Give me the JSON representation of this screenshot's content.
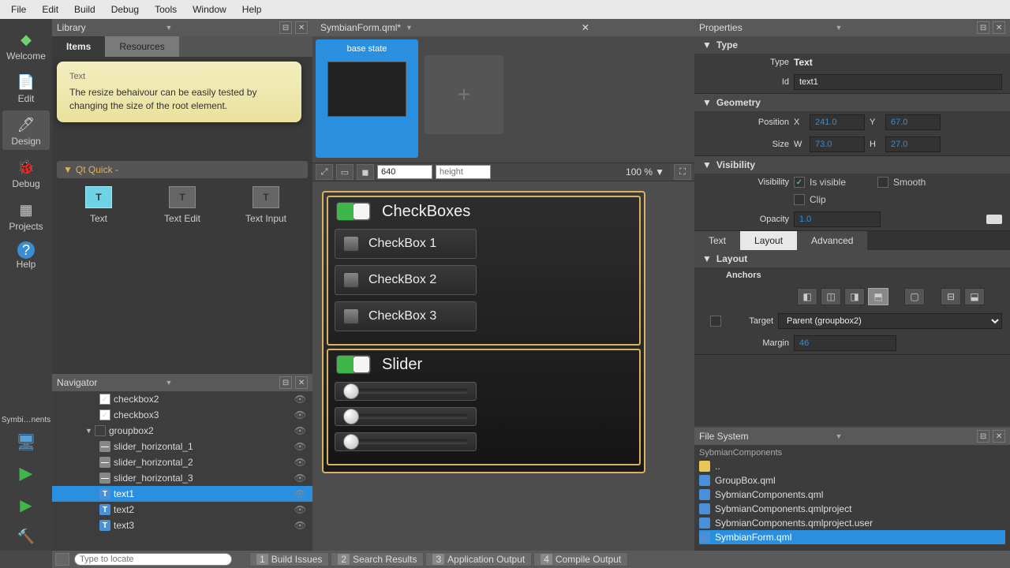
{
  "menu": [
    "File",
    "Edit",
    "Build",
    "Debug",
    "Tools",
    "Window",
    "Help"
  ],
  "sidebar": {
    "modes": [
      {
        "label": "Welcome",
        "icon": "◆"
      },
      {
        "label": "Edit",
        "icon": "✎"
      },
      {
        "label": "Design",
        "icon": "✐",
        "selected": true
      },
      {
        "label": "Debug",
        "icon": "🐞"
      },
      {
        "label": "Projects",
        "icon": "▦"
      },
      {
        "label": "Help",
        "icon": "?"
      }
    ],
    "target_label": "Symbi…nents"
  },
  "library": {
    "header": "Library",
    "tabs": [
      "Items",
      "Resources"
    ],
    "tooltip_title": "Text",
    "tooltip_body": "The resize behaivour can be easily tested by changing the size of the root element.",
    "section": "Qt Quick -",
    "items": [
      {
        "label": "Text",
        "selected": true
      },
      {
        "label": "Text Edit"
      },
      {
        "label": "Text Input"
      }
    ]
  },
  "navigator": {
    "header": "Navigator",
    "rows": [
      {
        "indent": 2,
        "check": true,
        "label": "checkbox2"
      },
      {
        "indent": 2,
        "check": true,
        "label": "checkbox3"
      },
      {
        "indent": 1,
        "arrow": true,
        "empty": true,
        "label": "groupbox2"
      },
      {
        "indent": 2,
        "slider": true,
        "label": "slider_horizontal_1"
      },
      {
        "indent": 2,
        "slider": true,
        "label": "slider_horizontal_2"
      },
      {
        "indent": 2,
        "slider": true,
        "label": "slider_horizontal_3"
      },
      {
        "indent": 2,
        "text": true,
        "label": "text1",
        "selected": true
      },
      {
        "indent": 2,
        "text": true,
        "label": "text2"
      },
      {
        "indent": 2,
        "text": true,
        "label": "text3"
      }
    ]
  },
  "editor": {
    "filename": "SymbianForm.qml*",
    "base_state": "base state",
    "width_input": "640",
    "height_placeholder": "height",
    "zoom": "100 %",
    "groupbox1": {
      "title": "CheckBoxes",
      "items": [
        "CheckBox 1",
        "CheckBox 2",
        "CheckBox 3"
      ]
    },
    "groupbox2": {
      "title": "Slider",
      "count": 3
    }
  },
  "properties": {
    "header": "Properties",
    "type_label": "Type",
    "type_value": "Text",
    "id_label": "Id",
    "id_value": "text1",
    "geometry": "Geometry",
    "position_label": "Position",
    "x_label": "X",
    "x_value": "241.0",
    "y_label": "Y",
    "y_value": "67.0",
    "size_label": "Size",
    "w_label": "W",
    "w_value": "73.0",
    "h_label": "H",
    "h_value": "27.0",
    "visibility": "Visibility",
    "vis_label": "Visibility",
    "is_visible": "Is visible",
    "smooth": "Smooth",
    "clip": "Clip",
    "opacity_label": "Opacity",
    "opacity_value": "1.0",
    "tabs": [
      "Text",
      "Layout",
      "Advanced"
    ],
    "layout": "Layout",
    "anchors": "Anchors",
    "target_label": "Target",
    "target_value": "Parent (groupbox2)",
    "margin_label": "Margin",
    "margin_value": "46"
  },
  "filesys": {
    "header": "File System",
    "root": "SybmianComponents",
    "items": [
      {
        "label": "..",
        "folder": true
      },
      {
        "label": "GroupBox.qml"
      },
      {
        "label": "SybmianComponents.qml"
      },
      {
        "label": "SybmianComponents.qmlproject"
      },
      {
        "label": "SybmianComponents.qmlproject.user"
      },
      {
        "label": "SymbianForm.qml",
        "selected": true
      }
    ]
  },
  "bottombar": {
    "search_placeholder": "Type to locate",
    "panes": [
      {
        "n": "1",
        "label": "Build Issues"
      },
      {
        "n": "2",
        "label": "Search Results"
      },
      {
        "n": "3",
        "label": "Application Output"
      },
      {
        "n": "4",
        "label": "Compile Output"
      }
    ]
  },
  "section_type": "Type"
}
